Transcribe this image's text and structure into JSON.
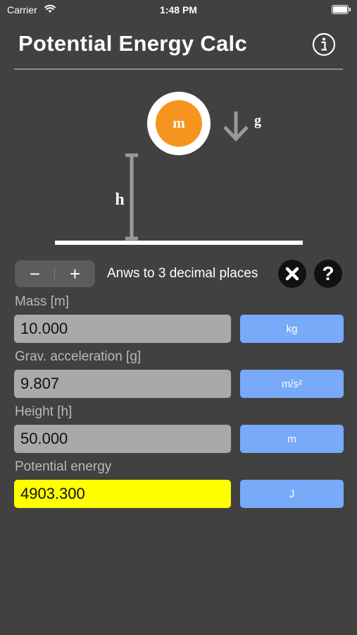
{
  "status_bar": {
    "carrier": "Carrier",
    "time": "1:48 PM"
  },
  "header": {
    "title": "Potential Energy Calc",
    "info_icon": "info-circle-icon"
  },
  "diagram": {
    "mass_symbol": "m",
    "gravity_symbol": "g",
    "height_symbol": "h"
  },
  "controls": {
    "minus_label": "−",
    "plus_label": "+",
    "precision_text": "Anws to 3 decimal places",
    "clear_icon": "close-x-icon",
    "help_label": "?"
  },
  "fields": [
    {
      "label": "Mass [m]",
      "value": "10.000",
      "unit": "kg"
    },
    {
      "label": "Grav. acceleration [g]",
      "value": "9.807",
      "unit": "m/s²"
    },
    {
      "label": "Height [h]",
      "value": "50.000",
      "unit": "m"
    },
    {
      "label": "Potential energy",
      "value": "4903.300",
      "unit": "J"
    }
  ],
  "colors": {
    "background": "#414141",
    "mass_circle": "#f7941d",
    "input_bg": "#a9a9a9",
    "result_bg": "#ffff00",
    "unit_button": "#78aaf9"
  }
}
